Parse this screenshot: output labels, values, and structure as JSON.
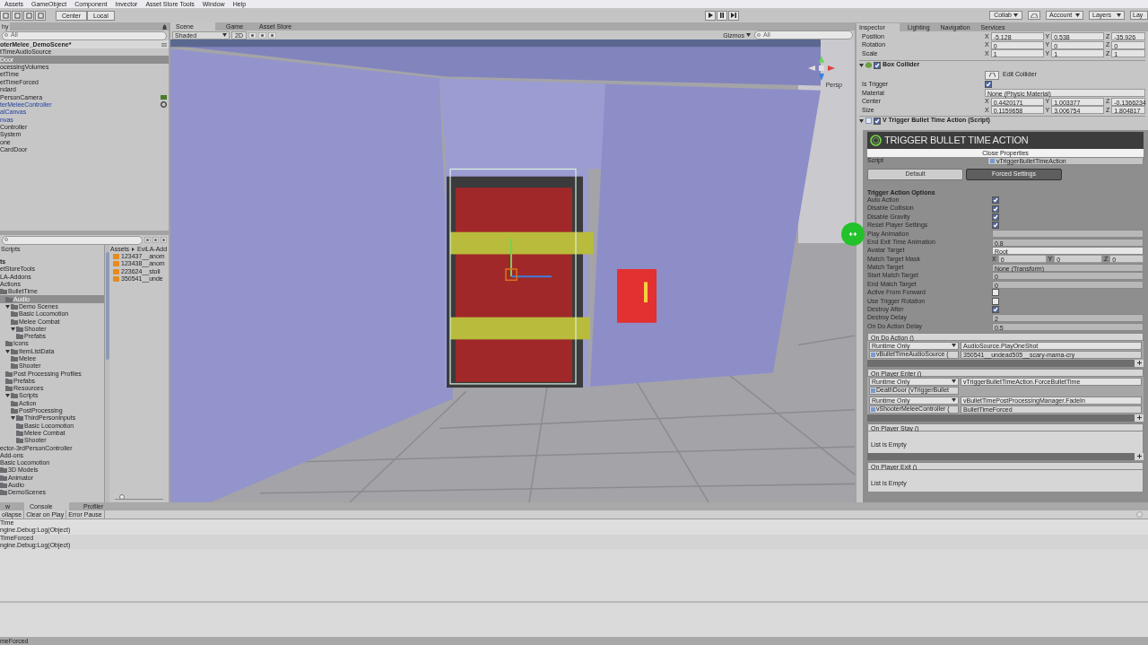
{
  "menu": [
    "Assets",
    "GameObject",
    "Component",
    "Invector",
    "Asset Store Tools",
    "Window",
    "Help"
  ],
  "toolbar": {
    "pivot": [
      "Center",
      "Local"
    ],
    "right": [
      "Collab",
      "Account",
      "Layers",
      "Lay"
    ]
  },
  "hierarchy": {
    "tab": "hy",
    "search": {
      "placeholder": "All"
    },
    "scene": "oterMelee_DemoScene*",
    "items": [
      {
        "label": "tTimeAudioSource",
        "kind": "object",
        "selected": false,
        "icon": false
      },
      {
        "label": "Door",
        "kind": "object",
        "selected": true,
        "icon": false
      },
      {
        "label": "ocessingVolumes",
        "kind": "object",
        "selected": false,
        "icon": false
      },
      {
        "label": "etTime",
        "kind": "object",
        "selected": false,
        "icon": false
      },
      {
        "label": "etTimeForced",
        "kind": "object",
        "selected": false,
        "icon": false
      },
      {
        "label": "ndard",
        "kind": "object",
        "selected": false,
        "icon": false
      },
      {
        "label": "PersonCamera",
        "kind": "object",
        "selected": false,
        "icon": true
      },
      {
        "label": "terMeleeController",
        "kind": "prefab",
        "selected": false,
        "icon": true
      },
      {
        "label": "alCanvas",
        "kind": "prefab",
        "selected": false,
        "icon": false
      },
      {
        "label": "nvas",
        "kind": "prefab",
        "selected": false,
        "icon": false
      },
      {
        "label": "Controller",
        "kind": "object",
        "selected": false,
        "icon": false
      },
      {
        "label": "System",
        "kind": "object",
        "selected": false,
        "icon": false
      },
      {
        "label": "one",
        "kind": "object",
        "selected": false,
        "icon": false
      },
      {
        "label": "CardDoor",
        "kind": "object",
        "selected": false,
        "icon": false
      }
    ]
  },
  "project": {
    "favorite": "Scripts",
    "tree": [
      {
        "label": "ts",
        "selected": false,
        "children": [
          {
            "label": "etStoreTools",
            "selected": false
          },
          {
            "label": "LA-Addons",
            "selected": false,
            "children": [
              {
                "label": "Actions",
                "selected": false,
                "children": [
                  {
                    "label": "BulletTime",
                    "selected": false,
                    "children": [
                      {
                        "label": "Audio",
                        "selected": true
                      },
                      {
                        "label": "Demo Scenes",
                        "selected": false,
                        "expanded": true,
                        "children": [
                          {
                            "label": "Basic Locomotion",
                            "selected": false
                          },
                          {
                            "label": "Melee Combat",
                            "selected": false
                          },
                          {
                            "label": "Shooter",
                            "selected": false,
                            "expanded": true,
                            "children": [
                              {
                                "label": "Prefabs",
                                "selected": false
                              }
                            ]
                          }
                        ]
                      },
                      {
                        "label": "Icons",
                        "selected": false
                      },
                      {
                        "label": "ItemListData",
                        "selected": false,
                        "expanded": true,
                        "children": [
                          {
                            "label": "Melee",
                            "selected": false
                          },
                          {
                            "label": "Shooter",
                            "selected": false
                          }
                        ]
                      },
                      {
                        "label": "Post Processing Profiles",
                        "selected": false
                      },
                      {
                        "label": "Prefabs",
                        "selected": false
                      },
                      {
                        "label": "Resources",
                        "selected": false
                      },
                      {
                        "label": "Scripts",
                        "selected": false,
                        "expanded": true,
                        "children": [
                          {
                            "label": "Action",
                            "selected": false
                          },
                          {
                            "label": "PostProcessing",
                            "selected": false
                          },
                          {
                            "label": "ThirdPersonInputs",
                            "selected": false,
                            "expanded": true,
                            "children": [
                              {
                                "label": "Basic Locomotion",
                                "selected": false
                              },
                              {
                                "label": "Melee Combat",
                                "selected": false
                              },
                              {
                                "label": "Shooter",
                                "selected": false
                              }
                            ]
                          }
                        ]
                      }
                    ]
                  }
                ]
              },
              {
                "label": "ector-3rdPersonController",
                "selected": false
              }
            ]
          },
          {
            "label": "Add-ons",
            "selected": false,
            "children": [
              {
                "label": "Basic Locomotion",
                "selected": false,
                "children": [
                  {
                    "label": "3D Models",
                    "selected": false
                  },
                  {
                    "label": "Animator",
                    "selected": false
                  },
                  {
                    "label": "Audio",
                    "selected": false
                  },
                  {
                    "label": "DemoScenes",
                    "selected": false
                  }
                ]
              }
            ]
          }
        ]
      }
    ],
    "breadcrumb": [
      "Assets",
      "EviLA-Add"
    ],
    "files": [
      "123437__anom",
      "123438__anom",
      "223624__stoll",
      "350541__unde"
    ],
    "zoom": {
      "level": 0.15
    }
  },
  "scene": {
    "tabs": [
      {
        "label": "Scene",
        "selected": true
      },
      {
        "label": "Game",
        "selected": false
      },
      {
        "label": "Asset Store",
        "selected": false
      }
    ],
    "shading": "Shaded",
    "mode_2d": "2D",
    "gizmos": "Gizmos",
    "search": {
      "placeholder": "All"
    },
    "projection": "Persp"
  },
  "inspector": {
    "tabs": [
      {
        "label": "Inspector",
        "selected": true
      },
      {
        "label": "Lighting",
        "selected": false
      },
      {
        "label": "Navigation",
        "selected": false
      },
      {
        "label": "Services",
        "selected": false
      }
    ],
    "transform": [
      {
        "label": "Position",
        "values": [
          {
            "axis": "X",
            "value": "-5.128"
          },
          {
            "axis": "Y",
            "value": "0.538"
          },
          {
            "axis": "Z",
            "value": "-35.926"
          }
        ]
      },
      {
        "label": "Rotation",
        "values": [
          {
            "axis": "X",
            "value": "0"
          },
          {
            "axis": "Y",
            "value": "0"
          },
          {
            "axis": "Z",
            "value": "0"
          }
        ]
      },
      {
        "label": "Scale",
        "values": [
          {
            "axis": "X",
            "value": "1"
          },
          {
            "axis": "Y",
            "value": "1"
          },
          {
            "axis": "Z",
            "value": "1"
          }
        ]
      }
    ],
    "box_collider": {
      "title": "Box Collider",
      "enabled": true,
      "edit_collider": "Edit Collider",
      "is_trigger": {
        "label": "Is Trigger",
        "checked": true
      },
      "material": {
        "label": "Material",
        "value": "None (Physic Material)"
      },
      "vectors": [
        {
          "label": "Center",
          "values": [
            {
              "axis": "X",
              "value": "0.4420171"
            },
            {
              "axis": "Y",
              "value": "1.003377"
            },
            {
              "axis": "Z",
              "value": "-0.1366234"
            }
          ]
        },
        {
          "label": "Size",
          "values": [
            {
              "axis": "X",
              "value": "0.1159658"
            },
            {
              "axis": "Y",
              "value": "3.006754"
            },
            {
              "axis": "Z",
              "value": "1.804817"
            }
          ]
        }
      ]
    },
    "script": {
      "title": "V Trigger Bullet Time Action (Script)",
      "enabled": true,
      "banner": "TRIGGER BULLET TIME ACTION",
      "close": "Close Properties",
      "script_label": "Script",
      "script_value": "vTriggerBulletTimeAction",
      "tabs": [
        {
          "label": "Default",
          "selected": false
        },
        {
          "label": "Forced Settings",
          "selected": true
        }
      ],
      "section": "Trigger Action Options",
      "properties": [
        {
          "label": "Auto Action",
          "kind": "checkbox",
          "checked": true
        },
        {
          "label": "Disable Collision",
          "kind": "checkbox",
          "checked": true
        },
        {
          "label": "Disable Gravity",
          "kind": "checkbox",
          "checked": true
        },
        {
          "label": "Reset Player Settings",
          "kind": "checkbox",
          "checked": true
        },
        {
          "label": "Play Animation",
          "kind": "field"
        },
        {
          "label": "End Exit Time Animation",
          "kind": "field",
          "value": "0.8"
        },
        {
          "label": "Avatar Target",
          "kind": "dropdown",
          "value": "Root"
        },
        {
          "label": "Match Target Mask",
          "kind": "vector",
          "values": [
            {
              "axis": "X",
              "value": "0"
            },
            {
              "axis": "Y",
              "value": "0"
            },
            {
              "axis": "Z",
              "value": "0"
            }
          ]
        },
        {
          "label": "Match Target",
          "kind": "field",
          "value": "None (Transform)"
        },
        {
          "label": "Start Match Target",
          "kind": "field",
          "value": "0"
        },
        {
          "label": "End Match Target",
          "kind": "field",
          "value": "0"
        },
        {
          "label": "Active From Forward",
          "kind": "checkbox",
          "checked": false
        },
        {
          "label": "Use Trigger Rotation",
          "kind": "checkbox",
          "checked": false
        },
        {
          "label": "Destroy After",
          "kind": "checkbox",
          "checked": true
        },
        {
          "label": "Destroy Delay",
          "kind": "field",
          "value": "2"
        },
        {
          "label": "On Do Action Delay",
          "kind": "field",
          "value": "0.5"
        }
      ],
      "events": [
        {
          "title": "On Do Action ()",
          "entries": [
            {
              "mode": "Runtime Only",
              "function": "AudioSource.PlayOneShot",
              "target": "vBulletTimeAudioSource (",
              "argument": "350541__undead505__scary-mama-cry"
            }
          ]
        },
        {
          "title": "On Player Enter ()",
          "entries": [
            {
              "mode": "Runtime Only",
              "function": "vTriggerBulletTimeAction.ForceBulletTime",
              "target": "DeathDoor (vTriggerBullet"
            },
            {
              "mode": "Runtime Only",
              "function": "vBulletTimePostProcessingManager.FadeIn",
              "target": "vShooterMeleeController (",
              "argument": "BulletTimeForced"
            }
          ]
        },
        {
          "title": "On Player Stay ()",
          "empty": "List is Empty"
        },
        {
          "title": "On Player Exit ()",
          "empty": "List is Empty"
        }
      ]
    }
  },
  "console": {
    "tabs": [
      {
        "label": "w",
        "selected": false
      },
      {
        "label": "Console",
        "selected": true
      },
      {
        "label": "Profiler",
        "selected": false
      }
    ],
    "buttons": [
      "ollapse",
      "Clear on Play",
      "Error Pause"
    ],
    "entries": [
      {
        "lines": [
          "Time",
          "ngine.Debug:Log(Object)"
        ]
      },
      {
        "lines": [
          "TimeForced",
          "ngine.Debug:Log(Object)"
        ]
      }
    ]
  },
  "status_bar": "meForced"
}
